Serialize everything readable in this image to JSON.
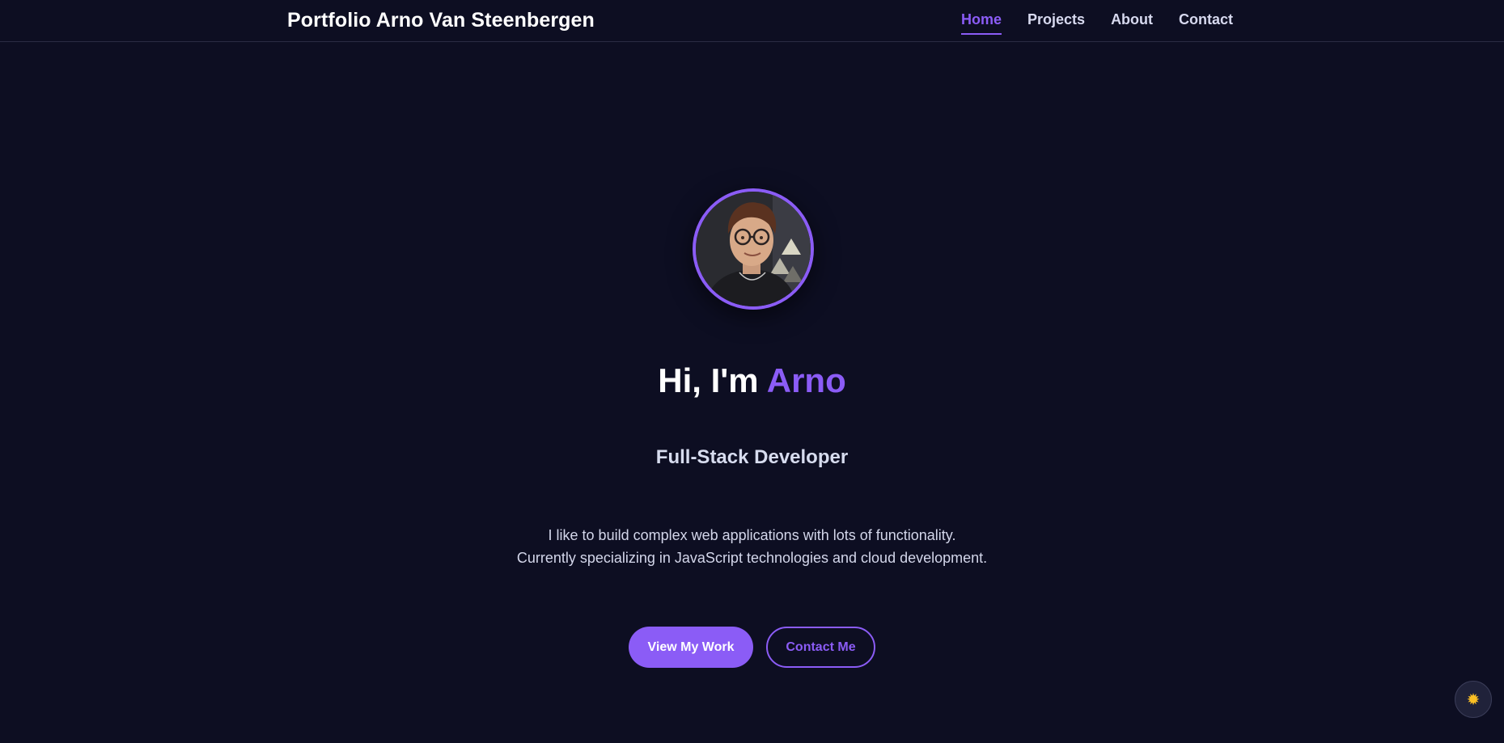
{
  "nav": {
    "brand": "Portfolio Arno Van Steenbergen",
    "links": [
      {
        "label": "Home",
        "active": true
      },
      {
        "label": "Projects",
        "active": false
      },
      {
        "label": "About",
        "active": false
      },
      {
        "label": "Contact",
        "active": false
      }
    ]
  },
  "hero": {
    "greeting": "Hi, I'm",
    "name": "Arno",
    "role": "Full-Stack Developer",
    "bio_lines": [
      "I like to build complex web applications with lots of functionality.",
      "Currently specializing in JavaScript technologies and cloud development."
    ],
    "primary_button": "View My Work",
    "secondary_button": "Contact Me"
  },
  "theme_toggle": {
    "icon": "sun-icon",
    "glyph": "✹"
  },
  "colors": {
    "background": "#0d0e22",
    "accent": "#8b5cf6",
    "text": "#ffffff",
    "muted_text": "#d3d6ea"
  }
}
